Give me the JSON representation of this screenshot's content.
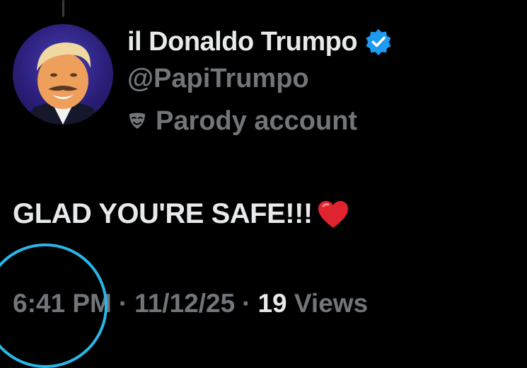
{
  "profile": {
    "display_name": "il Donaldo Trumpo",
    "handle": "@PapiTrumpo",
    "label_icon": "theater-mask-icon",
    "label": "Parody account",
    "verified_icon": "verified-badge-icon",
    "verified_color": "#1d9bf0"
  },
  "post": {
    "text": "GLAD YOU'RE SAFE!!!",
    "emoji": "❤️"
  },
  "meta": {
    "time": "6:41 PM",
    "separator": "·",
    "date": "11/12/25",
    "views_count": "19",
    "views_label": "Views"
  },
  "colors": {
    "background": "#000000",
    "primary_text": "#e7e9ea",
    "secondary_text": "#71767b",
    "highlight_circle": "#29b6e8"
  }
}
